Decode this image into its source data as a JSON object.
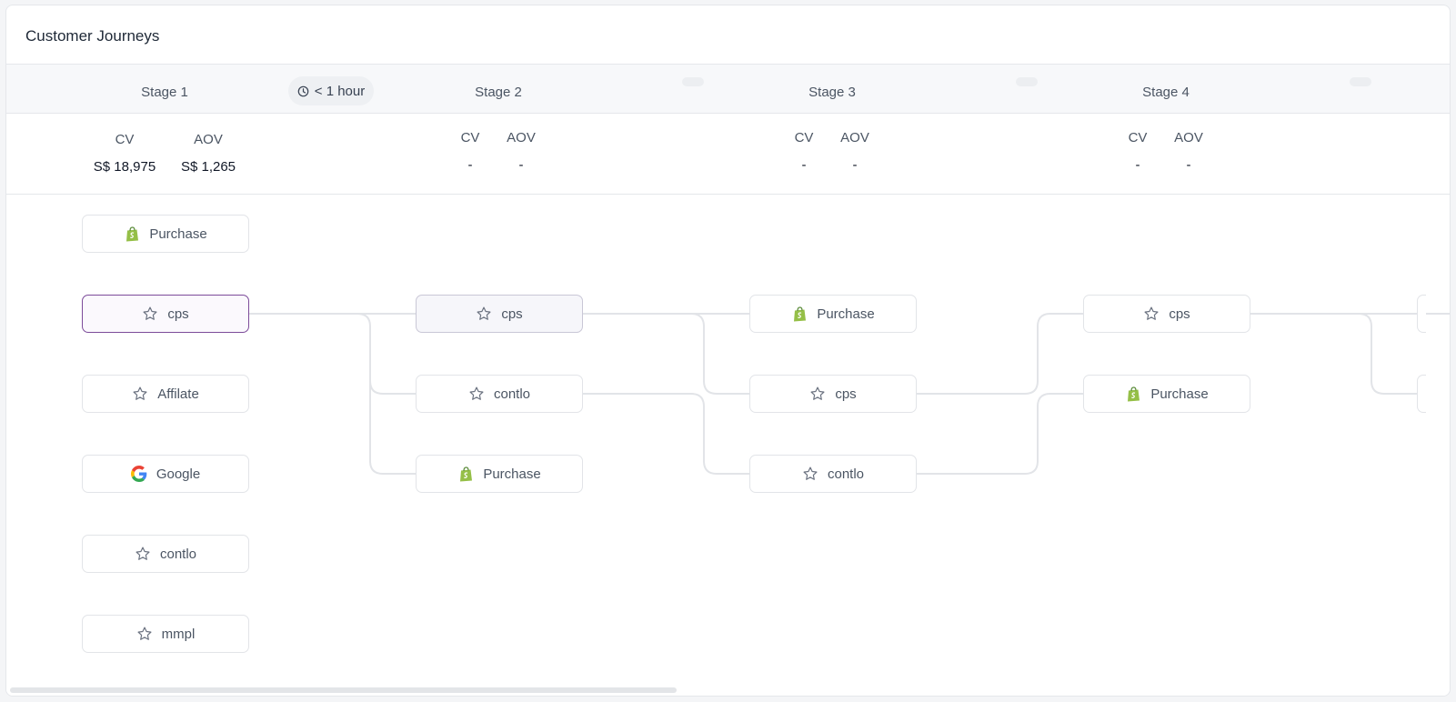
{
  "title": "Customer Journeys",
  "time_pill": "< 1 hour",
  "stages": [
    {
      "label": "Stage 1",
      "cv_label": "CV",
      "aov_label": "AOV",
      "cv": "S$ 18,975",
      "aov": "S$ 1,265"
    },
    {
      "label": "Stage 2",
      "cv_label": "CV",
      "aov_label": "AOV",
      "cv": "-",
      "aov": "-"
    },
    {
      "label": "Stage 3",
      "cv_label": "CV",
      "aov_label": "AOV",
      "cv": "-",
      "aov": "-"
    },
    {
      "label": "Stage 4",
      "cv_label": "CV",
      "aov_label": "AOV",
      "cv": "-",
      "aov": "-"
    }
  ],
  "nodes": {
    "s1": [
      {
        "label": "Purchase",
        "icon": "shopify-icon"
      },
      {
        "label": "cps",
        "icon": "star-icon",
        "state": "selected"
      },
      {
        "label": "Affilate",
        "icon": "star-icon"
      },
      {
        "label": "Google",
        "icon": "google-icon"
      },
      {
        "label": "contlo",
        "icon": "star-icon"
      },
      {
        "label": "mmpl",
        "icon": "star-icon"
      }
    ],
    "s2": [
      {
        "label": "cps",
        "icon": "star-icon",
        "state": "highlight"
      },
      {
        "label": "contlo",
        "icon": "star-icon"
      },
      {
        "label": "Purchase",
        "icon": "shopify-icon"
      }
    ],
    "s3": [
      {
        "label": "Purchase",
        "icon": "shopify-icon"
      },
      {
        "label": "cps",
        "icon": "star-icon"
      },
      {
        "label": "contlo",
        "icon": "star-icon"
      }
    ],
    "s4": [
      {
        "label": "cps",
        "icon": "star-icon"
      },
      {
        "label": "Purchase",
        "icon": "shopify-icon"
      }
    ]
  },
  "colors": {
    "accent": "#7c4b9a",
    "shopify": "#95bf47",
    "link": "#e2e4e8"
  }
}
